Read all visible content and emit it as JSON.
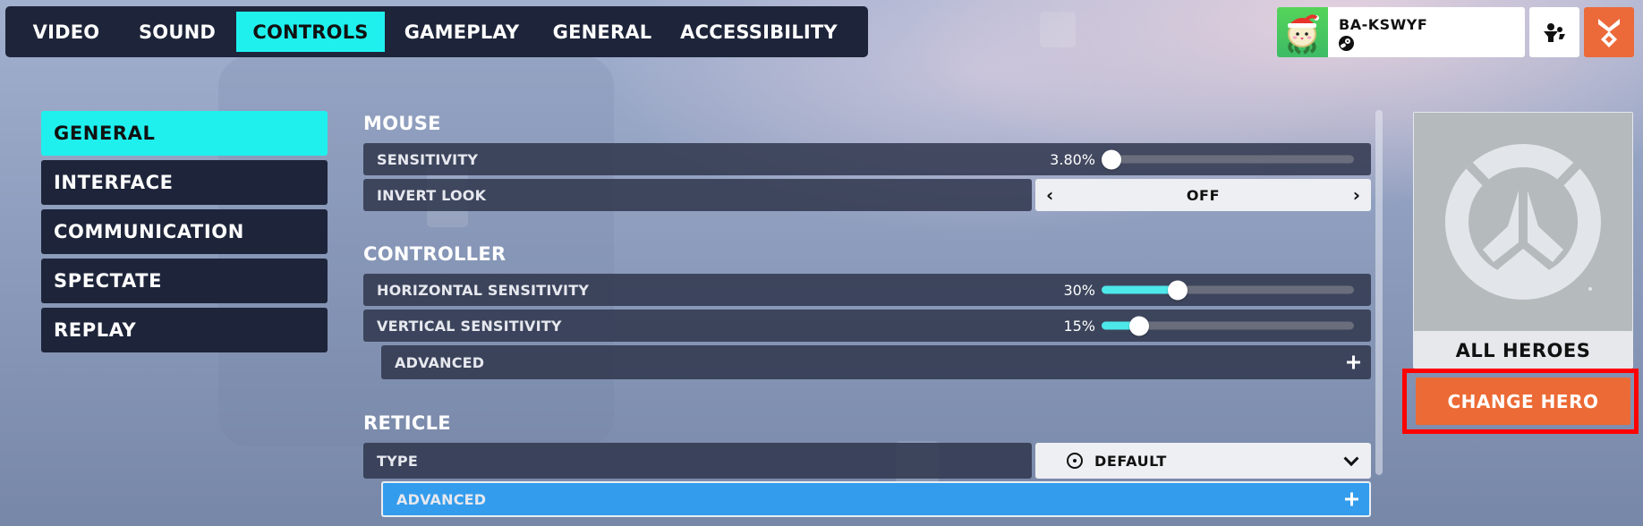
{
  "top_tabs": [
    {
      "label": "VIDEO",
      "active": false
    },
    {
      "label": "SOUND",
      "active": false
    },
    {
      "label": "CONTROLS",
      "active": true
    },
    {
      "label": "GAMEPLAY",
      "active": false
    },
    {
      "label": "GENERAL",
      "active": false
    },
    {
      "label": "ACCESSIBILITY",
      "active": false
    }
  ],
  "player": {
    "name": "BA-KSWYF",
    "avatar_icon": "pachimari-santa-icon",
    "platform_icon": "steam-icon"
  },
  "header_buttons": {
    "social_icon": "group-icon",
    "rewards_icon": "rewards-medal-icon"
  },
  "side_nav": [
    {
      "label": "GENERAL",
      "active": true
    },
    {
      "label": "INTERFACE",
      "active": false
    },
    {
      "label": "COMMUNICATION",
      "active": false
    },
    {
      "label": "SPECTATE",
      "active": false
    },
    {
      "label": "REPLAY",
      "active": false
    }
  ],
  "sections": {
    "mouse": {
      "title": "MOUSE",
      "sensitivity": {
        "label": "SENSITIVITY",
        "value_text": "3.80%",
        "fraction": 0.038
      },
      "invert_look": {
        "label": "INVERT LOOK",
        "value": "OFF"
      }
    },
    "controller": {
      "title": "CONTROLLER",
      "horizontal": {
        "label": "HORIZONTAL SENSITIVITY",
        "value_text": "30%",
        "fraction": 0.3
      },
      "vertical": {
        "label": "VERTICAL SENSITIVITY",
        "value_text": "15%",
        "fraction": 0.15
      },
      "advanced": {
        "label": "ADVANCED"
      }
    },
    "reticle": {
      "title": "RETICLE",
      "type": {
        "label": "TYPE",
        "value": "DEFAULT"
      },
      "advanced": {
        "label": "ADVANCED"
      }
    }
  },
  "hero_panel": {
    "hero_name": "ALL HEROES",
    "change_button": "CHANGE HERO",
    "logo_icon": "overwatch-logo-icon"
  },
  "colors": {
    "accent_cyan": "#1ff0ee",
    "nav_dark": "#1e253a",
    "orange": "#ec6a35",
    "highlight_blue": "#339ced",
    "annotation_red": "#ff0000"
  }
}
